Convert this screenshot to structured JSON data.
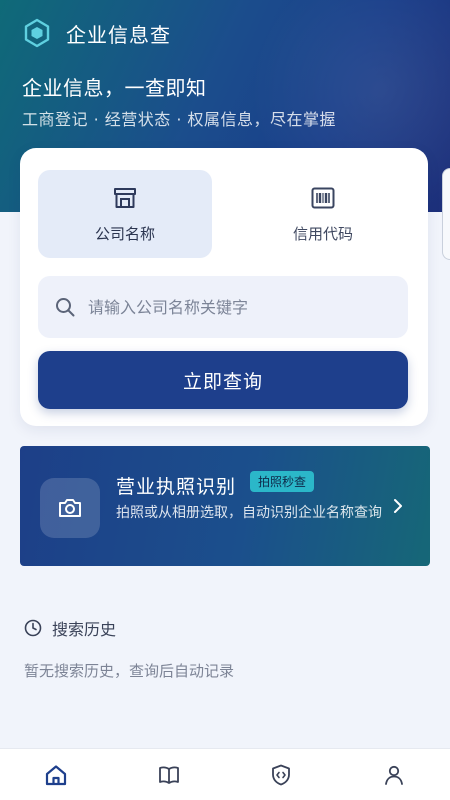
{
  "header": {
    "app_title": "企业信息查",
    "slogan": "企业信息，一查即知",
    "sub_slogan": "工商登记 · 经营状态 · 权属信息，尽在掌握"
  },
  "search_card": {
    "tabs": [
      {
        "label": "公司名称",
        "icon": "store-icon",
        "active": true
      },
      {
        "label": "信用代码",
        "icon": "barcode-icon",
        "active": false
      }
    ],
    "search_placeholder": "请输入公司名称关键字",
    "search_value": "",
    "query_button_label": "立即查询"
  },
  "license_card": {
    "title": "营业执照识别",
    "badge": "拍照秒查",
    "description": "拍照或从相册选取，自动识别企业名称查询",
    "icon": "camera-icon"
  },
  "history": {
    "title": "搜索历史",
    "empty_text": "暂无搜索历史，查询后自动记录"
  },
  "bottom_nav": [
    {
      "icon": "home-icon",
      "active": true
    },
    {
      "icon": "book-icon",
      "active": false
    },
    {
      "icon": "shield-code-icon",
      "active": false
    },
    {
      "icon": "user-icon",
      "active": false
    }
  ],
  "colors": {
    "primary": "#1e3f8c",
    "accent": "#2bb7c9",
    "background": "#f1f4fb"
  }
}
